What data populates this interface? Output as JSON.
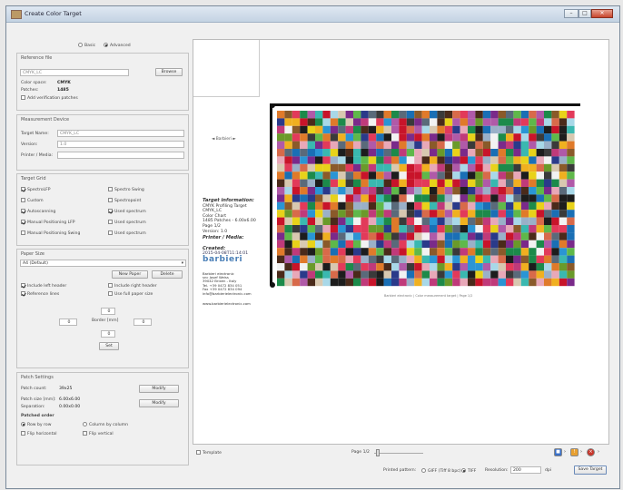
{
  "window": {
    "title": "Create Color Target"
  },
  "mode": {
    "basic_label": "Basic",
    "advanced_label": "Advanced",
    "selected": "advanced"
  },
  "reference_file": {
    "section_title": "Reference file",
    "file_value": "CMYK_LC",
    "browse_label": "Browse",
    "color_space_label": "Color space:",
    "color_space_value": "CMYK",
    "patches_label": "Patches:",
    "patches_value": "1485",
    "add_verification_label": "Add verification patches"
  },
  "measurement_device": {
    "section_title": "Measurement Device",
    "target_name_label": "Target Name:",
    "target_name_value": "CMYK_LC",
    "version_label": "Version:",
    "version_value": "1.0",
    "printer_media_label": "Printer / Media:",
    "printer_media_value": ""
  },
  "target_grid": {
    "section_title": "Target Grid",
    "checks": [
      {
        "label": "SpectroLFP",
        "checked": true
      },
      {
        "label": "Spectro Swing",
        "checked": false
      },
      {
        "label": "Custom",
        "checked": false
      },
      {
        "label": "Spectropoint",
        "checked": false
      },
      {
        "label": "Autoscanning",
        "checked": true
      },
      {
        "label": "Used spectrum",
        "checked": true
      },
      {
        "label": "Manual Positioning LFP",
        "checked": true
      },
      {
        "label": "Used spectrum",
        "checked": false
      },
      {
        "label": "Manual Positioning Swing",
        "checked": false
      },
      {
        "label": "Used spectrum",
        "checked": false
      }
    ]
  },
  "paper_size": {
    "section_title": "Paper Size",
    "selected": "A4 (Default)",
    "new_paper_label": "New Paper",
    "delete_label": "Delete",
    "include_left_header": "Include left header",
    "include_right_header": "Include right header",
    "reference_lines": "Reference lines",
    "use_full_paper": "Use full paper size",
    "border_label": "Border [mm]",
    "top": "0",
    "left": "0",
    "right": "0",
    "bottom": "0",
    "set_label": "Set"
  },
  "patch_settings": {
    "section_title": "Patch Settings",
    "patch_count_label": "Patch count:",
    "patch_count_value": "39x25",
    "patch_size_label": "Patch size [mm]:",
    "patch_size_value": "6.00x6.00",
    "separation_label": "Separation:",
    "separation_value": "0.00x0.00",
    "modify_label": "Modify",
    "modify2_label": "Modify",
    "patched_order_label": "Patched order",
    "row_by_row": "Row by row",
    "column_by_column": "Column by column",
    "flip_horizontal": "Flip horizontal",
    "flip_vertical": "Flip vertical"
  },
  "preview": {
    "small_label": "◄ Barbieri ►",
    "info_title": "Target information:",
    "info_lines": [
      "CMYK Profiling Target",
      "CMYK_LC",
      "Color Chart",
      "1485 Patches - 6.00x6.00",
      "Page 1/2",
      "Version: 1.0"
    ],
    "printer_heading": "Printer / Media:",
    "created_heading": "Created:",
    "created_value": "2015-04-08T11:14:01",
    "brand": "barbieri",
    "contact_lines": [
      "Barbieri electronic",
      "snc Josef Weiss",
      "39042 Brixen - Italy",
      "Tel. +39 0472 834 051",
      "Fax +39 0472 834 094",
      "info@barbierielectronic.com"
    ],
    "website": "www.barbierielectronic.com",
    "caption": "Barbieri electronic  |  Color measurement target  |  Page 1/2"
  },
  "bottom": {
    "template_label": "Template",
    "page_label": "Page 1/2",
    "printed_pattern_label": "Printed pattern:",
    "opt1": "GIFF (Tiff 8 bpc)",
    "opt2": "TIFF",
    "resolution_label": "Resolution:",
    "resolution_value": "200",
    "dpi": "dpi",
    "save_label": "Save Target"
  },
  "chart_colors": {
    "frame": "#111111"
  }
}
